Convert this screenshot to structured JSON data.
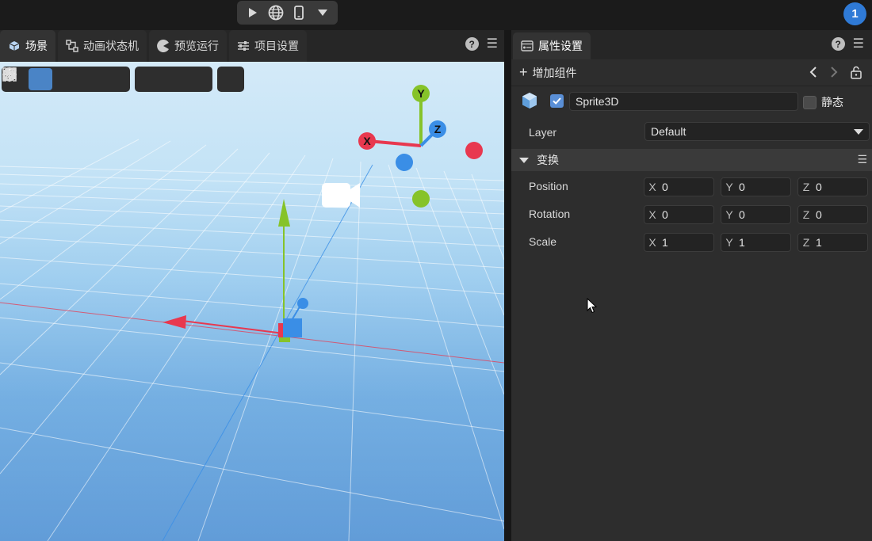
{
  "top_bar": {
    "play_icon": "play-icon",
    "globe_icon": "globe-icon",
    "phone_icon": "phone-icon",
    "dropdown_icon": "chevron-down-icon",
    "user_badge": "1"
  },
  "left_panel": {
    "tabs": [
      {
        "label": "场景",
        "icon": "scene-icon",
        "active": true
      },
      {
        "label": "动画状态机",
        "icon": "state-machine-icon",
        "active": false
      },
      {
        "label": "预览运行",
        "icon": "preview-icon",
        "active": false
      },
      {
        "label": "项目设置",
        "icon": "settings-sliders-icon",
        "active": false
      }
    ],
    "help_label": "?",
    "menu_label": "☰"
  },
  "viewport_toolbar": {
    "transform_tools": [
      "hand-icon",
      "move-icon",
      "rotate-icon",
      "scale-icon",
      "rect-icon"
    ],
    "view_tools": [
      "box-2d-icon",
      "cube-icon",
      "camera-icon"
    ],
    "stats_tool": "activity-icon",
    "active_tool": "move-icon"
  },
  "gizmo": {
    "x_label": "X",
    "y_label": "Y",
    "z_label": "Z",
    "colors": {
      "x": "#e8384f",
      "y": "#86c32a",
      "z": "#3a8ee6"
    }
  },
  "right_panel": {
    "tab_label": "属性设置",
    "help_label": "?",
    "menu_label": "☰",
    "add_component_label": "增加组件",
    "object": {
      "name": "Sprite3D",
      "enabled": true,
      "static_label": "静态",
      "static_checked": false
    },
    "layer": {
      "label": "Layer",
      "value": "Default"
    },
    "transform": {
      "header": "变换",
      "rows": [
        {
          "label": "Position",
          "x": "0",
          "y": "0",
          "z": "0"
        },
        {
          "label": "Rotation",
          "x": "0",
          "y": "0",
          "z": "0"
        },
        {
          "label": "Scale",
          "x": "1",
          "y": "1",
          "z": "1"
        }
      ],
      "axis_labels": {
        "x": "X",
        "y": "Y",
        "z": "Z"
      }
    }
  }
}
